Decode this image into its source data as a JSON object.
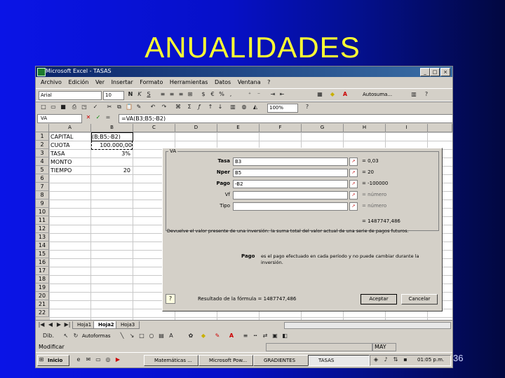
{
  "slide": {
    "title": "ANUALIDADES",
    "number": "36"
  },
  "window": {
    "title": "Microsoft Excel - TASAS"
  },
  "menu": [
    "Archivo",
    "Edición",
    "Ver",
    "Insertar",
    "Formato",
    "Herramientas",
    "Datos",
    "Ventana",
    "?"
  ],
  "format_toolbar": {
    "font": "Arial",
    "size": "10",
    "autosum": "Autosuma..."
  },
  "std_toolbar": {
    "zoom": "100%"
  },
  "formula_bar": {
    "name_box": "VA",
    "formula": "=VA(B3;B5;-B2)"
  },
  "columns": [
    "A",
    "B",
    "C",
    "D",
    "E",
    "F",
    "G",
    "H",
    "I"
  ],
  "rows": [
    "1",
    "2",
    "3",
    "4",
    "5",
    "6",
    "7",
    "8",
    "9",
    "10",
    "11",
    "12",
    "13",
    "14",
    "15",
    "16",
    "17",
    "18",
    "19",
    "20",
    "21",
    "22"
  ],
  "cells": {
    "a1": "CAPITAL",
    "b1": "(B;B5;-B2)",
    "a2": "CUOTA",
    "b2": "100.000,00",
    "a3": "TASA",
    "b3": "3%",
    "a4": "MONTO",
    "a5": "TIEMPO",
    "b5": "20"
  },
  "dialog": {
    "group": "VA",
    "args": [
      {
        "label": "Tasa",
        "value": "B3",
        "result": "= 0,03"
      },
      {
        "label": "Nper",
        "value": "B5",
        "result": "= 20"
      },
      {
        "label": "Pago",
        "value": "-B2",
        "result": "= -100000"
      },
      {
        "label": "Vf",
        "value": "",
        "result": "= número"
      },
      {
        "label": "Tipo",
        "value": "",
        "result": "= número"
      }
    ],
    "total_result": "= 1487747,486",
    "description": "Devuelve el valor presente de una inversión: la suma total del valor actual de una serie de pagos futuros.",
    "pago_label": "Pago",
    "pago_desc": "es el pago efectuado en cada período y no puede cambiar durante la inversión.",
    "formula_result": "Resultado de la fórmula = 1487747,486",
    "ok": "Aceptar",
    "cancel": "Cancelar"
  },
  "sheets": [
    "Hoja1",
    "Hoja2",
    "Hoja3"
  ],
  "active_sheet": "Hoja2",
  "draw_toolbar": {
    "autoshapes": "Autoformas"
  },
  "status": {
    "left": "Modificar",
    "right": "MAY"
  },
  "taskbar": {
    "start": "Inicio",
    "tasks": [
      "Matemáticas ...",
      "Microsoft Pow...",
      "GRADIENTES",
      "TASAS"
    ],
    "active_task": "TASAS",
    "clock": "01:05 p.m."
  },
  "colors": {
    "slide_bg": "#0a14e6",
    "title": "#ffff33",
    "window_face": "#d4d0c8",
    "titlebar": "#0a246a"
  }
}
